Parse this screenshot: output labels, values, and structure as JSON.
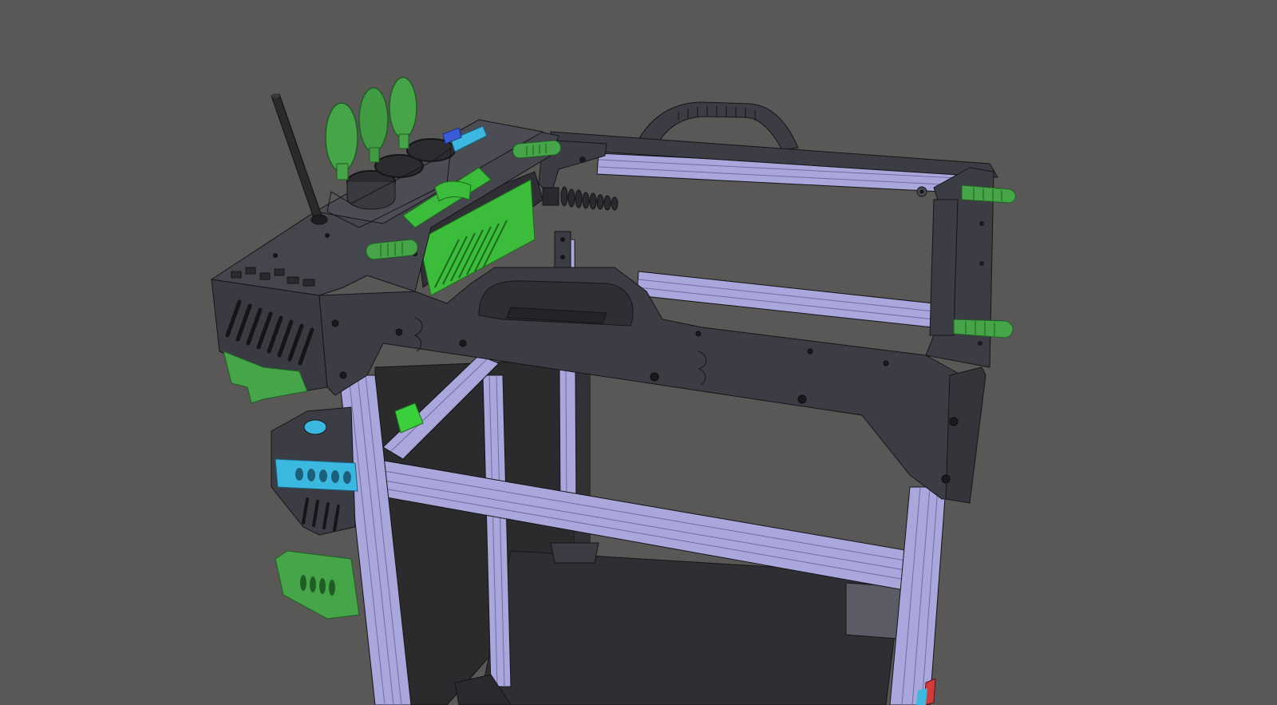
{
  "viewport": {
    "background_color": "#595856",
    "kind": "3d-cad-model-view"
  },
  "model": {
    "subject": "3d-printer-frame-top-corner",
    "colors": {
      "frame_extrusion": "#a9a7dc",
      "frame_extrusion_shade": "#8c8ac2",
      "printed_parts_dark": "#3c3c44",
      "printed_parts_dark_shade": "#2e2e34",
      "accent_green": "#4fa34a",
      "accent_green_bright": "#3ccf3c",
      "accent_cyan": "#3ab8e0",
      "accent_blue": "#3b5bd8",
      "interior_black": "#28282b",
      "antenna": "#2a2a2a",
      "edge_lines": "#151518"
    },
    "parts": [
      "antenna",
      "cable-gland-covers",
      "top-rear-handle",
      "top-front-handle",
      "top-frame-panels",
      "aluminium-extrusions",
      "green-panel-clips",
      "electronics-bay-green-board",
      "cyan-connector-housing",
      "green-bottom-bracket",
      "cable-drag-spring"
    ]
  }
}
